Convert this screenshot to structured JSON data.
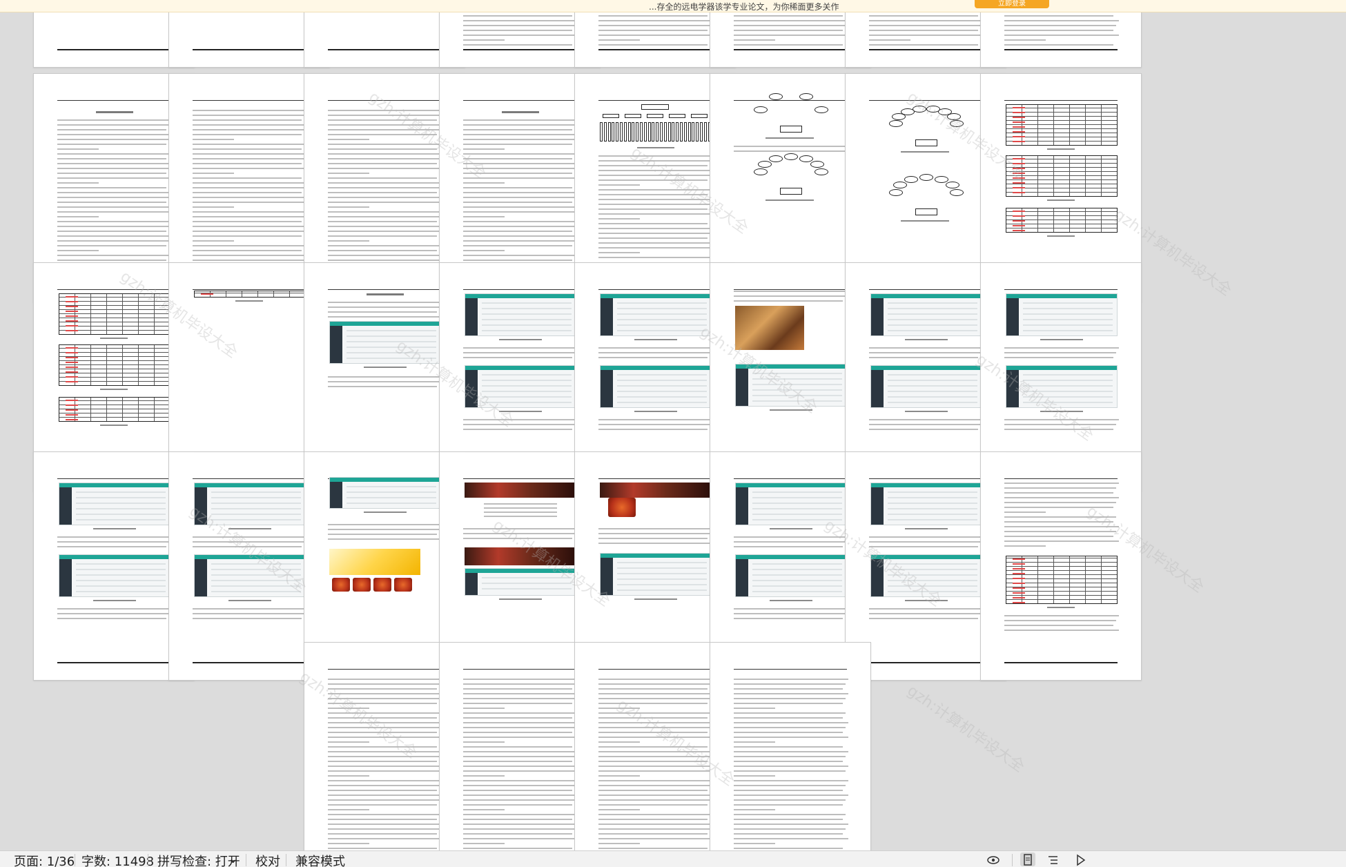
{
  "notification": {
    "message": "...存全的远电学器该学专业论文，为你稀面更多关作",
    "cta_label": "立即登录"
  },
  "watermark": "gzh:计算机毕设大全",
  "statusbar": {
    "page": "页面: 1/36",
    "word_count": "字数: 11498",
    "spellcheck": "拼写检查: 打开",
    "proofread": "校对",
    "compat_mode": "兼容模式"
  },
  "icons": {
    "eye": "eye-icon",
    "page_view": "page-view-icon",
    "list_view": "list-view-icon",
    "play": "play-icon"
  },
  "colors": {
    "accent_teal": "#1ea596",
    "cta_orange": "#f5a623",
    "page_bg": "#dcdcdc"
  }
}
